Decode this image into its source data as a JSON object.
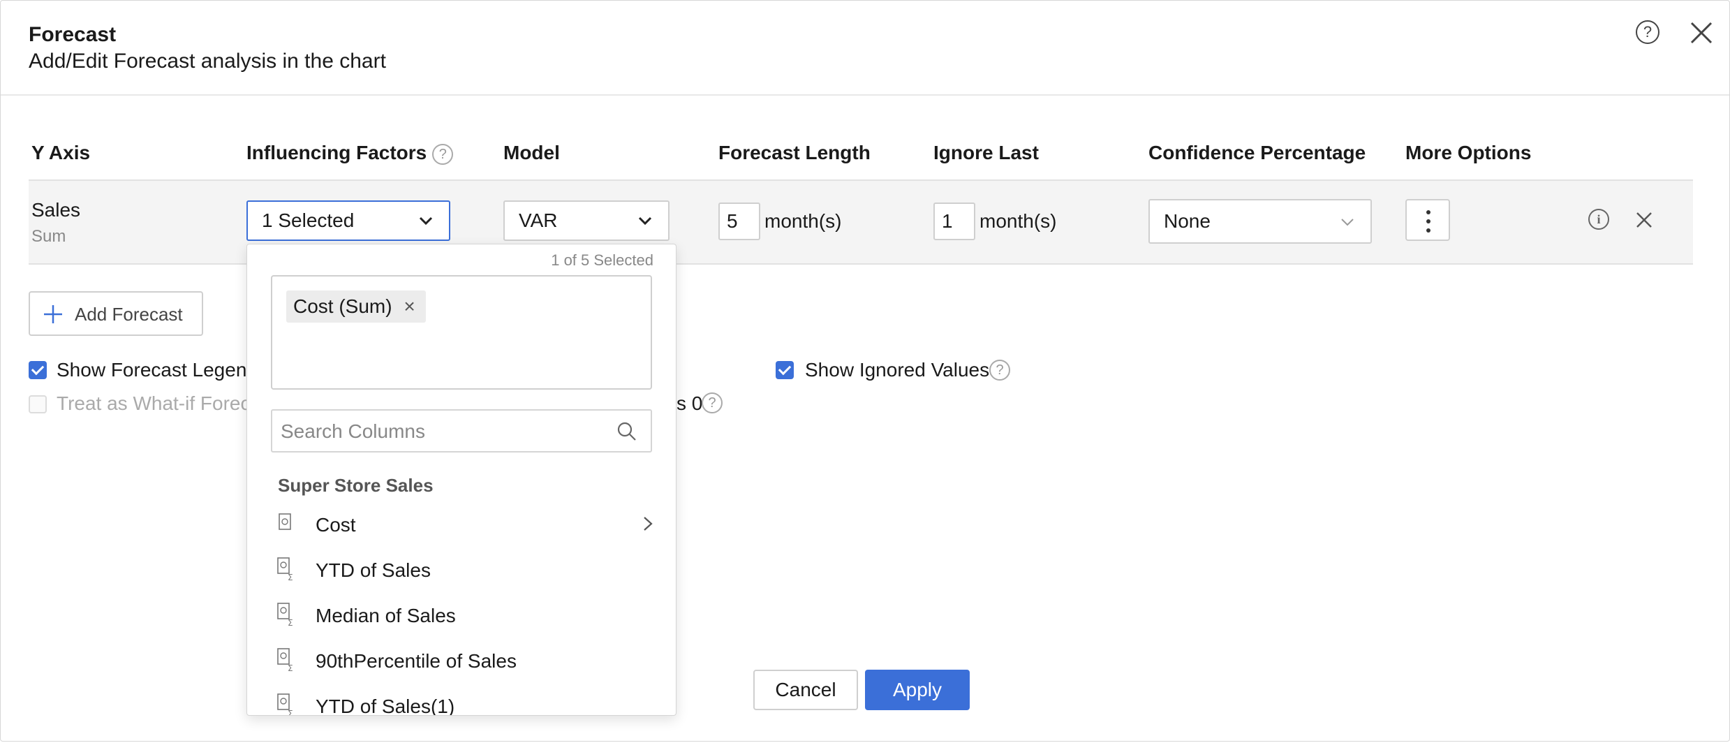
{
  "header": {
    "title": "Forecast",
    "subtitle": "Add/Edit Forecast analysis in the chart",
    "help_icon": "?",
    "close_icon": "close-icon"
  },
  "columns": {
    "y_axis": "Y Axis",
    "influencing_factors": "Influencing Factors",
    "model": "Model",
    "forecast_length": "Forecast Length",
    "ignore_last": "Ignore Last",
    "confidence_percentage": "Confidence Percentage",
    "more_options": "More Options"
  },
  "row": {
    "y_axis_name": "Sales",
    "y_axis_agg": "Sum",
    "influencing_value": "1 Selected",
    "model_value": "VAR",
    "forecast_length_value": "5",
    "forecast_length_unit": "month(s)",
    "ignore_last_value": "1",
    "ignore_last_unit": "month(s)",
    "confidence_value": "None",
    "info_icon": "i"
  },
  "add_forecast_label": "Add Forecast",
  "options": {
    "show_forecast_legend": "Show Forecast Legend",
    "treat_as_whatif": "Treat as What-if Forec",
    "partial_text": "s 0",
    "show_ignored_values": "Show Ignored Values"
  },
  "footer": {
    "cancel": "Cancel",
    "apply": "Apply"
  },
  "dropdown": {
    "selected_count": "1 of 5 Selected",
    "chip_label": "Cost (Sum)",
    "chip_remove": "×",
    "search_placeholder": "Search Columns",
    "group_title": "Super Store Sales",
    "items": [
      {
        "label": "Cost"
      },
      {
        "label": "YTD of Sales"
      },
      {
        "label": "Median of Sales"
      },
      {
        "label": "90thPercentile of Sales"
      },
      {
        "label": "YTD of Sales(1)"
      }
    ]
  },
  "colors": {
    "accent": "#3b6fd8",
    "row_band": "#f4f4f4"
  }
}
